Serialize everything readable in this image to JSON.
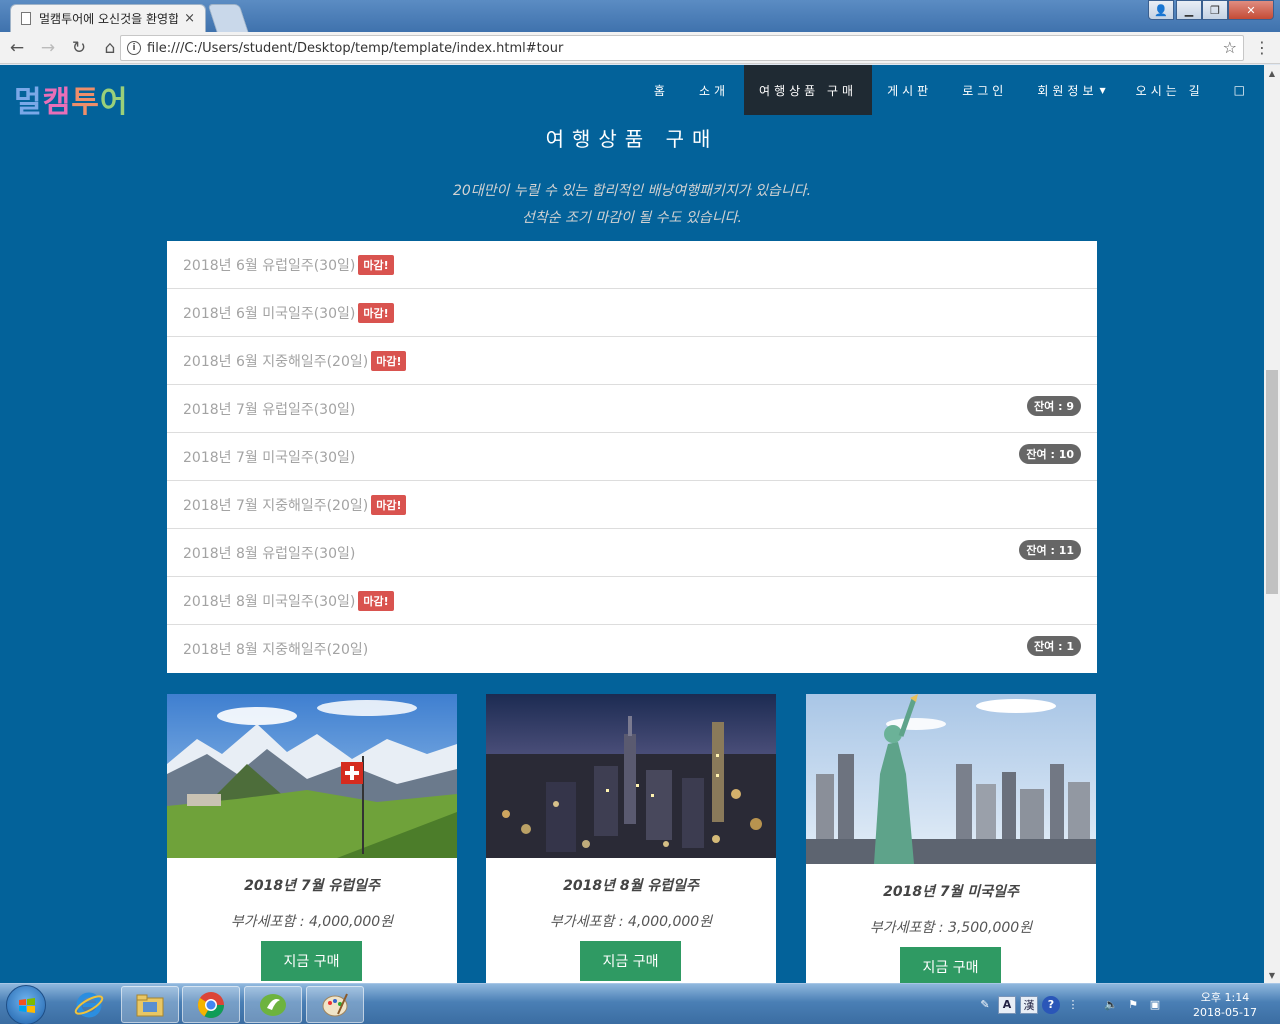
{
  "browser": {
    "tab_title": "멀캠투어에 오신것을 환영합니다",
    "tab_close": "×",
    "url": "file:///C:/Users/student/Desktop/temp/template/index.html#tour"
  },
  "site": {
    "logo_text": "멀캠투어",
    "nav": [
      {
        "label": "홈"
      },
      {
        "label": "소개"
      },
      {
        "label": "여행상품 구매"
      },
      {
        "label": "게시판"
      },
      {
        "label": "로그인"
      },
      {
        "label": "회원정보"
      },
      {
        "label": "오시는 길"
      },
      {
        "label": "□"
      }
    ],
    "section_title": "여행상품 구매",
    "subtitle_line1": "20대만이 누릴 수 있는 합리적인 배낭여행패키지가 있습니다.",
    "subtitle_line2": "선착순 조기 마감이 될 수도 있습니다."
  },
  "tours": [
    {
      "name": "2018년 6월 유럽일주(30일)",
      "badge": "마감!",
      "remaining": null
    },
    {
      "name": "2018년 6월 미국일주(30일)",
      "badge": "마감!",
      "remaining": null
    },
    {
      "name": "2018년 6월 지중해일주(20일)",
      "badge": "마감!",
      "remaining": null
    },
    {
      "name": "2018년 7월 유럽일주(30일)",
      "badge": null,
      "remaining": "잔여 : 9"
    },
    {
      "name": "2018년 7월 미국일주(30일)",
      "badge": null,
      "remaining": "잔여 : 10"
    },
    {
      "name": "2018년 7월 지중해일주(20일)",
      "badge": "마감!",
      "remaining": null
    },
    {
      "name": "2018년 8월 유럽일주(30일)",
      "badge": null,
      "remaining": "잔여 : 11"
    },
    {
      "name": "2018년 8월 미국일주(30일)",
      "badge": "마감!",
      "remaining": null
    },
    {
      "name": "2018년 8월 지중해일주(20일)",
      "badge": null,
      "remaining": "잔여 : 1"
    }
  ],
  "cards": [
    {
      "title": "2018년 7월 유럽일주",
      "price": "부가세포함 : 4,000,000원",
      "button": "지금 구매"
    },
    {
      "title": "2018년 8월 유럽일주",
      "price": "부가세포함 : 4,000,000원",
      "button": "지금 구매"
    },
    {
      "title": "2018년 7월 미국일주",
      "price": "부가세포함 : 3,500,000원",
      "button": "지금 구매"
    }
  ],
  "taskbar": {
    "clock_time": "오후 1:14",
    "clock_date": "2018-05-17",
    "ime_a": "A",
    "ime_han": "漢"
  },
  "colors": {
    "page_bg": "#03629a",
    "nav_active": "#1f2a33",
    "badge_closed": "#d9534f",
    "badge_remaining": "#666666",
    "buy_button": "#2f9a63"
  }
}
